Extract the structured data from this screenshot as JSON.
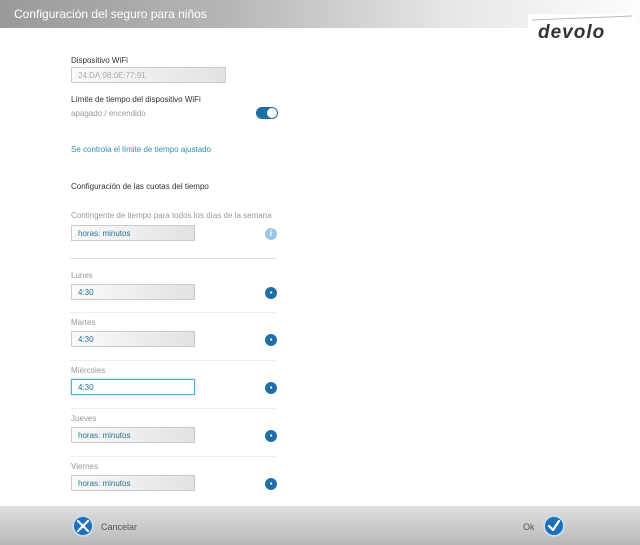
{
  "window": {
    "title": "Configuración del seguro para niños"
  },
  "brand": {
    "logo_text": "devolo"
  },
  "device": {
    "label": "Dispositivo WiFi",
    "value": "24:DA:98:0E:77:91"
  },
  "time_limit": {
    "label": "Límite de tiempo del dispositivo WiFi",
    "state_text": "apagado / encendido",
    "enabled": true,
    "hint": "Se controla el límite de tiempo ajustado"
  },
  "quotas": {
    "heading": "Configuración de las cuotas del tiempo",
    "all_days_label": "Contingente de tiempo para todos los días de la semana",
    "all_days_value": "horas: minutos",
    "days": [
      {
        "label": "Lunes",
        "value": "4:30"
      },
      {
        "label": "Martes",
        "value": "4:30"
      },
      {
        "label": "Miércoles",
        "value": "4:30"
      },
      {
        "label": "Jueves",
        "value": "horas: minutos"
      },
      {
        "label": "Viernes",
        "value": "horas: minutos"
      }
    ]
  },
  "footer": {
    "cancel_label": "Cancelar",
    "ok_label": "Ok"
  },
  "colors": {
    "accent": "#1f6fa8",
    "link": "#2f8fb8"
  }
}
